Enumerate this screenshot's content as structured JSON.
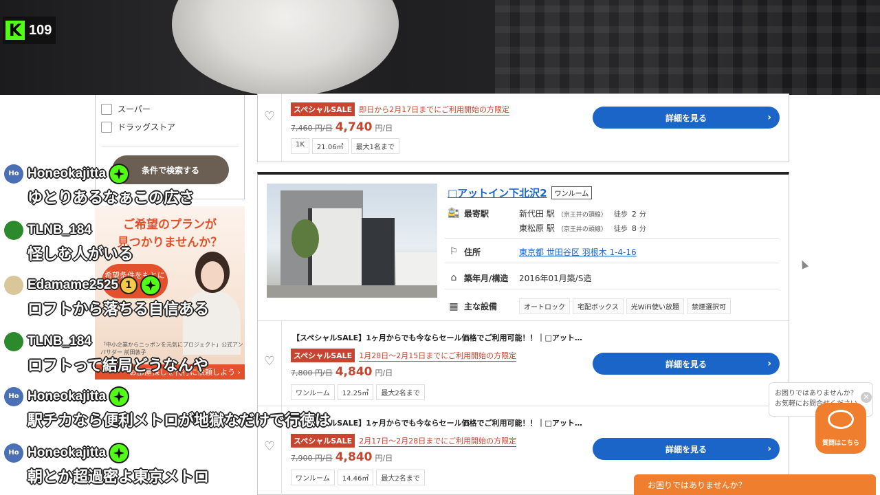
{
  "stream": {
    "viewer_count": "109"
  },
  "sidebar": {
    "checkboxes": [
      {
        "label": "スーパー",
        "checked": false
      },
      {
        "label": "ドラッグストア",
        "checked": false
      }
    ],
    "search_button_label": "条件で検索する"
  },
  "ad": {
    "title_line1": "ご希望のプランが",
    "title_line2": "見つかりませんか？",
    "bubble_text": "希望条件をもとに",
    "caption": "「中小企業からニッポンを元気にプロジェクト」公式アンバサダー 前田敦子",
    "footer_text": "お部屋探しを代行に依頼しよう ›"
  },
  "prev_listing": {
    "sale_badge": "スペシャルSALE",
    "sale_note": "即日から2月17日までにご利用開始の方限定",
    "old_price": "7,460 円/日",
    "new_price": "4,740",
    "price_unit": "円/日",
    "tags": [
      "1K",
      "21.06㎡",
      "最大1名まで"
    ],
    "detail_button": "詳細を見る"
  },
  "listing": {
    "name": "□アットイン下北沢2",
    "type_badge": "ワンルーム",
    "labels": {
      "station": "最寄駅",
      "address": "住所",
      "built": "築年月/構造",
      "facilities": "主な設備"
    },
    "stations": [
      {
        "name": "新代田 駅",
        "line": "（京王井の頭線）",
        "walk": "徒歩",
        "minutes": "2",
        "unit": "分"
      },
      {
        "name": "東松原 駅",
        "line": "（京王井の頭線）",
        "walk": "徒歩",
        "minutes": "8",
        "unit": "分"
      }
    ],
    "address": "東京都 世田谷区 羽根木 1-4-16",
    "built": "2016年01月築/S造",
    "facilities": [
      "オートロック",
      "宅配ボックス",
      "光WiFi使い放題",
      "禁煙選択可"
    ]
  },
  "plans": [
    {
      "title": "【スペシャルSALE】1ヶ月からでも今ならセール価格でご利用可能！！｜□アット…",
      "sale_badge": "スペシャルSALE",
      "sale_note": "1月28日〜2月15日までにご利用開始の方限定",
      "old_price": "7,800 円/日",
      "new_price": "4,840",
      "price_unit": "円/日",
      "tags": [
        "ワンルーム",
        "12.25㎡",
        "最大2名まで"
      ],
      "detail_button": "詳細を見る"
    },
    {
      "title": "【スペシャルSALE】1ヶ月からでも今ならセール価格でご利用可能！！｜□アット…",
      "sale_badge": "スペシャルSALE",
      "sale_note": "2月17日〜2月28日までにご利用開始の方限定",
      "old_price": "7,900 円/日",
      "new_price": "4,840",
      "price_unit": "円/日",
      "tags": [
        "ワンルーム",
        "14.46㎡",
        "最大2名まで"
      ],
      "detail_button": "詳細を見る"
    }
  ],
  "help": {
    "bubble_line1": "お困りではありませんか？",
    "bubble_line2": "お気軽にお問合せください",
    "button_label": "質問はこちら",
    "bar_label": "お困りではありませんか？"
  },
  "chat": [
    {
      "user": "Honeokajitta",
      "avatar": "Ho",
      "avatar_color": "#4a6fb5",
      "badge": true,
      "text": "ゆとりあるなぁこの広さ"
    },
    {
      "user": "TLNB_184",
      "avatar": "",
      "avatar_color": "#2c8a2c",
      "badge": false,
      "text": "怪しむ人がいる"
    },
    {
      "user": "Edamame2525",
      "avatar": "",
      "avatar_color": "#d9c79a",
      "badge": true,
      "num_badge": "1",
      "text": "ロフトから落ちる自信ある"
    },
    {
      "user": "TLNB_184",
      "avatar": "",
      "avatar_color": "#2c8a2c",
      "badge": false,
      "text": "ロフトって結局どうなんや"
    },
    {
      "user": "Honeokajitta",
      "avatar": "Ho",
      "avatar_color": "#4a6fb5",
      "badge": true,
      "text": "駅チカなら便利メトロが地獄なだけで行徳は"
    },
    {
      "user": "Honeokajitta",
      "avatar": "Ho",
      "avatar_color": "#4a6fb5",
      "badge": true,
      "text": "朝とか超過密よ東京メトロ"
    }
  ],
  "colors": {
    "accent_blue": "#1b64c8",
    "sale_red": "#c8442e",
    "help_orange": "#ef7f2f",
    "kick_green": "#53fc18"
  }
}
